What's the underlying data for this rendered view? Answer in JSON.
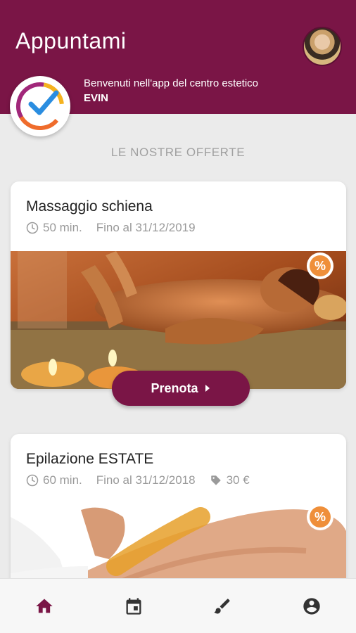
{
  "header": {
    "title": "Appuntami",
    "welcome_line": "Benvenuti nell'app del centro estetico",
    "center_name": "EVIN",
    "avatar_icon": "user-avatar",
    "logo_icon": "clock-logo"
  },
  "section_title": "LE NOSTRE OFFERTE",
  "offers": [
    {
      "title": "Massaggio schiena",
      "duration": "50 min.",
      "valid_until": "Fino al 31/12/2019",
      "price": "",
      "badge": "%",
      "cta": "Prenota"
    },
    {
      "title": "Epilazione ESTATE",
      "duration": "60 min.",
      "valid_until": "Fino al 31/12/2018",
      "price": "30 €",
      "badge": "%"
    }
  ],
  "bottom_nav": [
    {
      "icon": "home-icon",
      "active": true
    },
    {
      "icon": "calendar-icon",
      "active": false
    },
    {
      "icon": "brush-icon",
      "active": false
    },
    {
      "icon": "account-icon",
      "active": false
    }
  ],
  "colors": {
    "primary": "#7a1546",
    "accent": "#ef8f3a",
    "background": "#ebebeb",
    "muted_text": "#9a9a9a",
    "nav_inactive": "#333333"
  }
}
